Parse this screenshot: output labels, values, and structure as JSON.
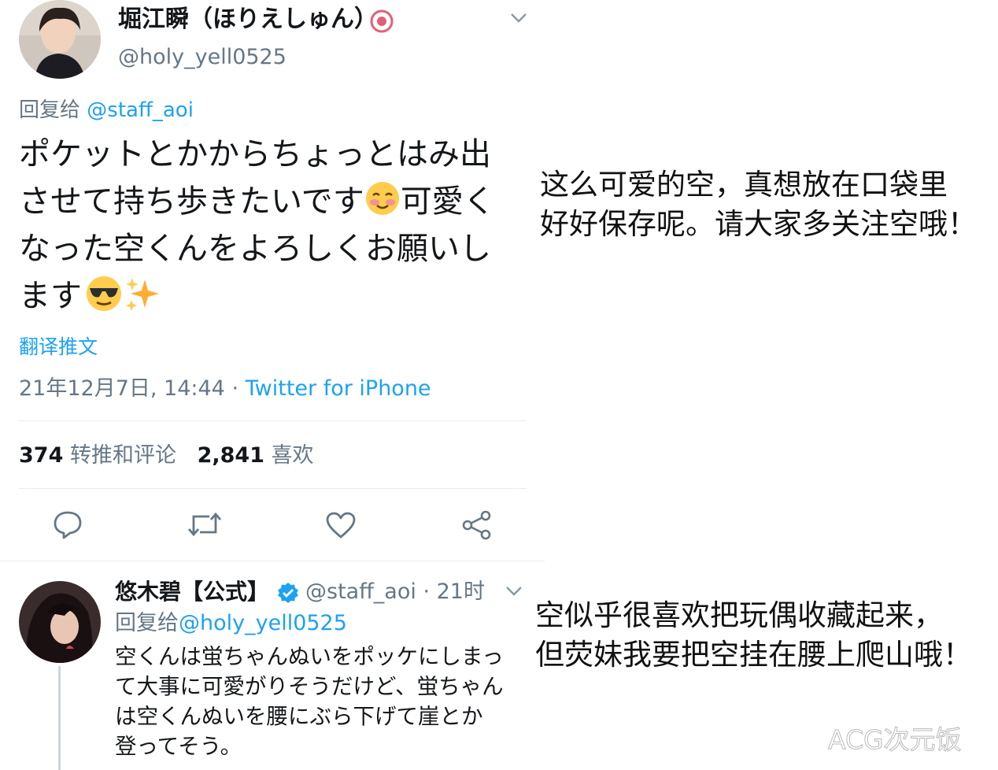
{
  "tweet1": {
    "display_name": "堀江瞬（ほりえしゅん）",
    "handle": "@holy_yell0525",
    "reply_to_prefix": "回复给",
    "reply_to_handle": "@staff_aoi",
    "body_lines": [
      "ポケットとかからちょっとはみ出",
      "させて持ち歩きたいです",
      "可愛く",
      "なった空くんをよろしくお願いし",
      "ます"
    ],
    "translate_label": "翻译推文",
    "timestamp": "21年12月7日, 14:44 · ",
    "client": "Twitter for iPhone",
    "retweet_count": "374",
    "retweet_label": "转推和评论",
    "like_count": "2,841",
    "like_label": "喜欢"
  },
  "tweet2": {
    "display_name": "悠木碧【公式】",
    "handle_time": "@staff_aoi · 21时",
    "reply_to_prefix": "回复给",
    "reply_to_handle": "@holy_yell0525",
    "body_lines": [
      "空くんは蛍ちゃんぬいをポッケにしまっ",
      "て大事に可愛がりそうだけど、蛍ちゃん",
      "は空くんぬいを腰にぶら下げて崖とか",
      "登ってそう。"
    ]
  },
  "captions": {
    "first": [
      "这么可爱的空，真想放在口袋里",
      "好好保存呢。请大家多关注空哦！"
    ],
    "second": [
      "空似乎很喜欢把玩偶收藏起来，",
      "但荧妹我要把空挂在腰上爬山哦！"
    ]
  },
  "watermark": "ACG次元饭",
  "colors": {
    "link": "#1da1f2",
    "secondary": "#657786",
    "verified": "#1da1f2"
  },
  "icons": [
    "chevron-down-icon",
    "reply-icon",
    "retweet-icon",
    "like-icon",
    "share-icon",
    "verified-badge-icon",
    "blush-emoji-icon",
    "sunglasses-emoji-icon",
    "sparkles-emoji-icon"
  ]
}
